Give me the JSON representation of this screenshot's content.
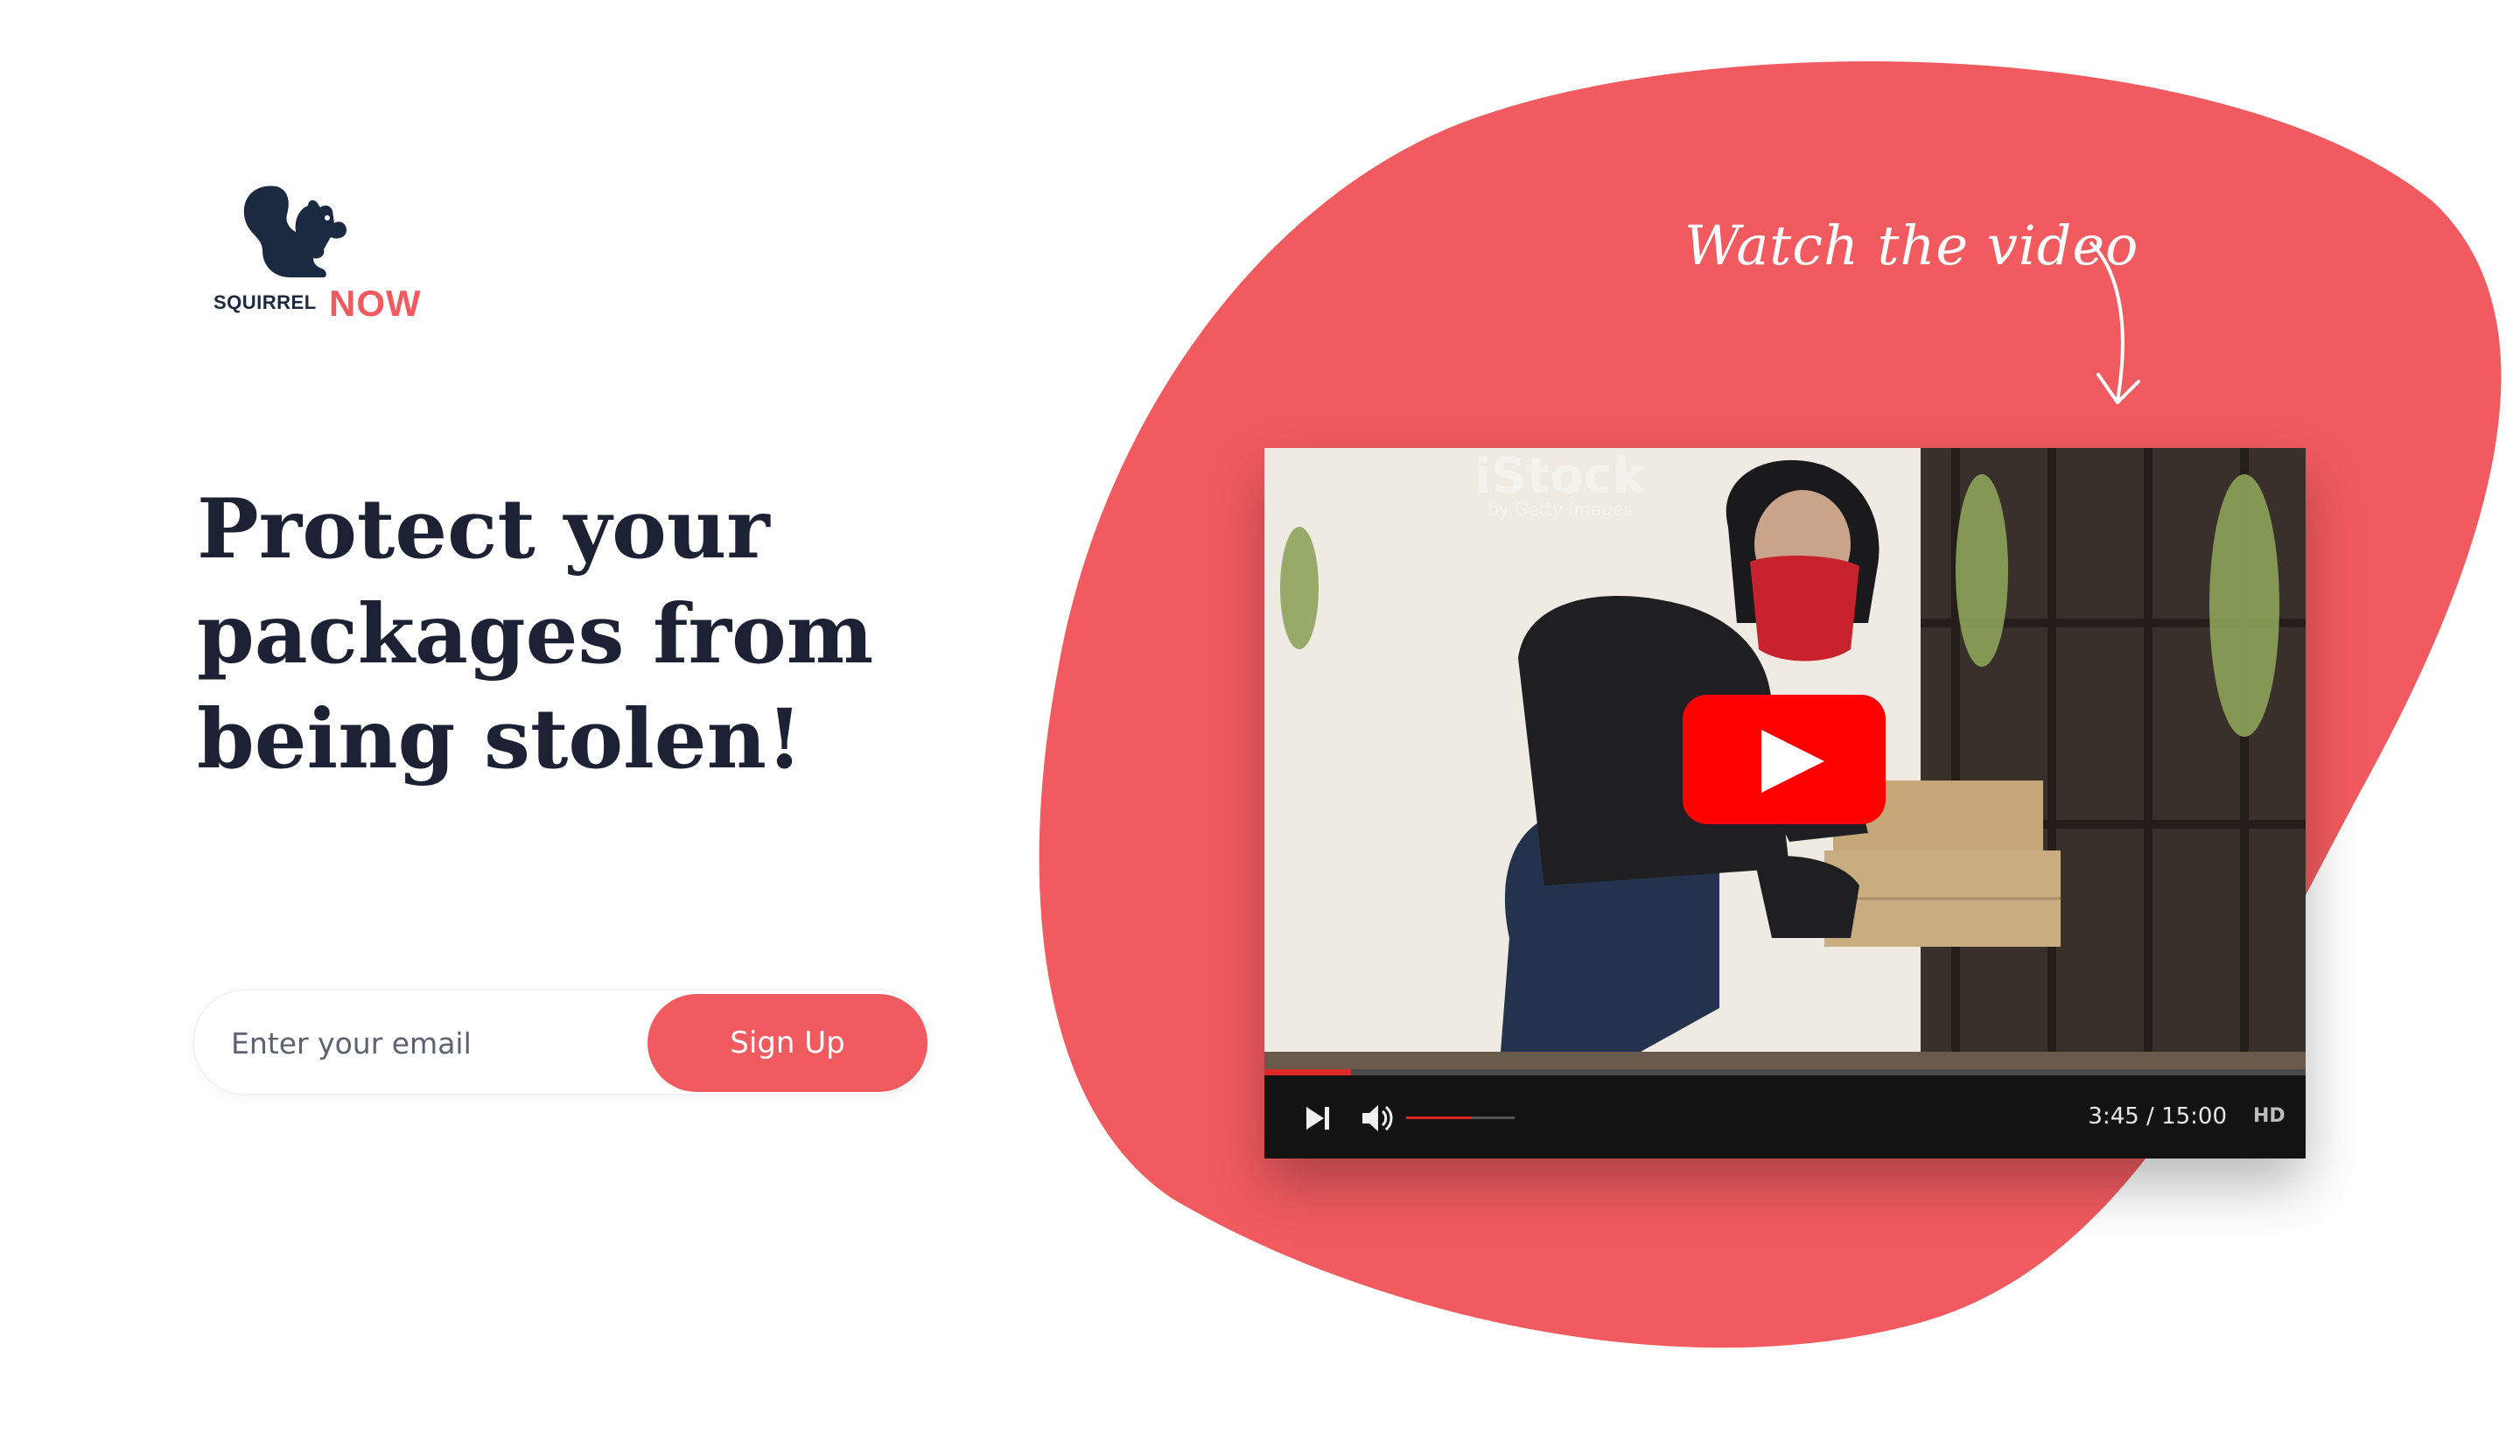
{
  "logo": {
    "word1": "SQUIRREL",
    "word2": "NOW"
  },
  "hero": {
    "headline": "Protect your packages from being stolen!"
  },
  "signup": {
    "email_placeholder": "Enter your email",
    "button_label": "Sign Up"
  },
  "video": {
    "callout": "Watch the video",
    "time_display": "3:45 / 15:00",
    "quality_label": "HD",
    "progress_fraction": 0.083,
    "volume_fraction": 0.6,
    "watermark_text": "iStock",
    "watermark_sub": "by Getty Images"
  },
  "colors": {
    "accent": "#f15b5f",
    "navy": "#1b2a41",
    "play_red": "#ff0000"
  }
}
